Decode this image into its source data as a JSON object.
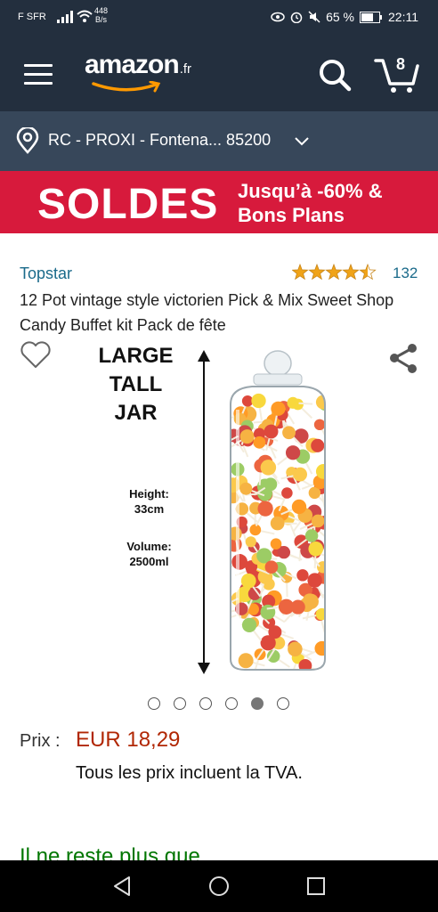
{
  "status": {
    "carrier": "F SFR",
    "speed_top": "448",
    "speed_bottom": "B/s",
    "battery": "65 %",
    "time": "22:11"
  },
  "header": {
    "logo": "amazon",
    "logo_tld": ".fr",
    "cart_count": "8"
  },
  "location": {
    "text": "RC - PROXI - Fontena... 85200"
  },
  "banner": {
    "big": "SOLDES",
    "line1": "Jusqu’à -60% &",
    "line2": "Bons Plans"
  },
  "product": {
    "brand": "Topstar",
    "rating": 4.5,
    "reviews": "132",
    "title": "12 Pot vintage style victorien Pick & Mix Sweet Shop Candy Buffet kit Pack de fête",
    "image_text": {
      "line1": "LARGE",
      "line2": "TALL",
      "line3": "JAR",
      "height_label": "Height:",
      "height_value": "33cm",
      "volume_label": "Volume:",
      "volume_value": "2500ml"
    },
    "carousel": {
      "count": 6,
      "active": 5
    },
    "price_label": "Prix :",
    "price_value": "EUR 18,29",
    "tva": "Tous les prix incluent la TVA.",
    "stock": "Il ne reste plus que"
  },
  "colors": {
    "header_bg": "#232f3e",
    "location_bg": "#37475a",
    "banner_bg": "#d71a3c",
    "link": "#1a6a8a",
    "price": "#b12704",
    "stock": "#007600",
    "star": "#f0a318"
  },
  "icons": [
    "menu-icon",
    "search-icon",
    "cart-icon",
    "location-pin-icon",
    "chevron-down-icon",
    "heart-icon",
    "share-icon",
    "back-icon",
    "home-icon",
    "recents-icon"
  ]
}
